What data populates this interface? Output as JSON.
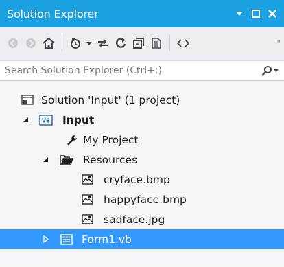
{
  "window": {
    "title": "Solution Explorer",
    "accent_color": "#1ba1e2",
    "selection_color": "#3399ff"
  },
  "search": {
    "placeholder": "Search Solution Explorer (Ctrl+;)"
  },
  "toolbar": {
    "buttons": [
      "back-icon",
      "forward-icon",
      "home-icon",
      "history-icon",
      "sync-icon",
      "refresh-icon",
      "collapse-all-icon",
      "show-all-files-icon",
      "view-code-icon"
    ]
  },
  "tree": {
    "solution": "Solution 'Input' (1 project)",
    "project": "Input",
    "my_project": "My Project",
    "resources": "Resources",
    "files": [
      "cryface.bmp",
      "happyface.bmp",
      "sadface.jpg"
    ],
    "form": "Form1.vb"
  }
}
